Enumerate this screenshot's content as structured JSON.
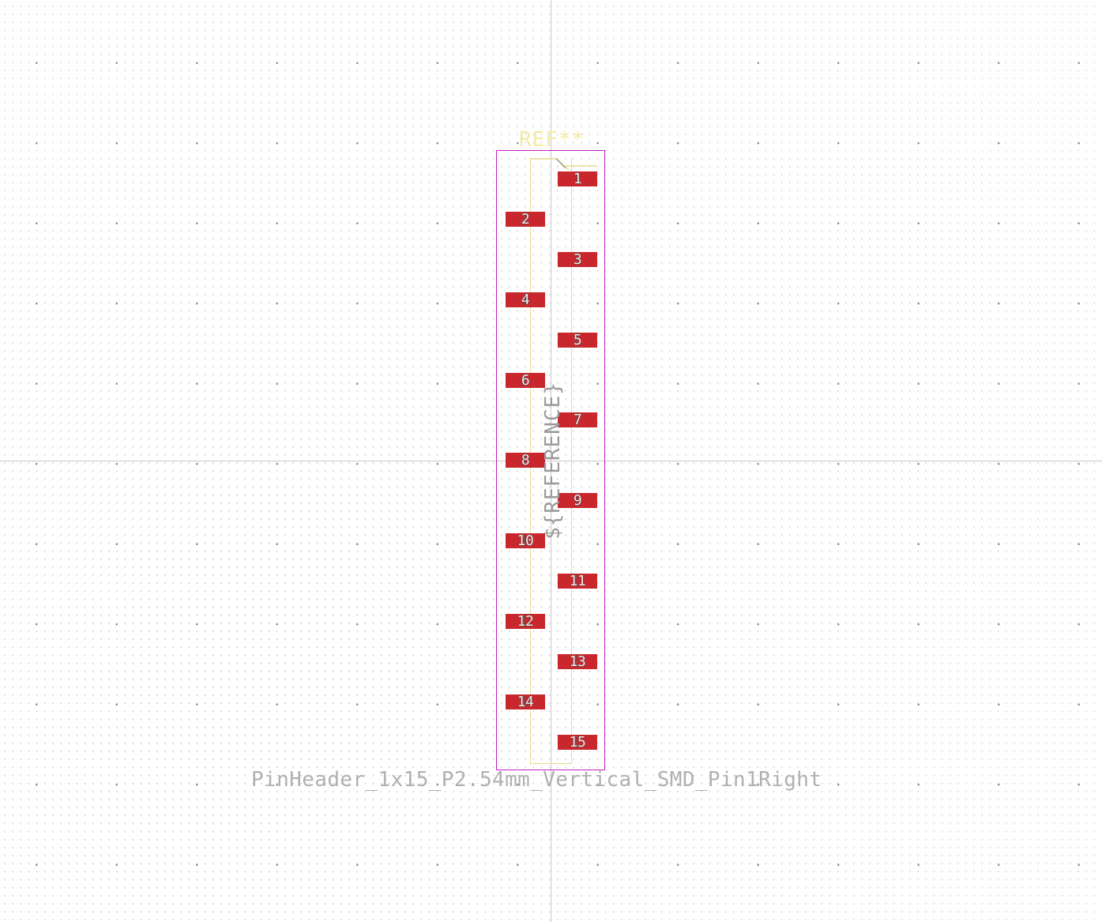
{
  "footprint": {
    "reference": "REF**",
    "reference_field": "${REFERENCE}",
    "value": "PinHeader_1x15_P2.54mm_Vertical_SMD_Pin1Right"
  },
  "pads": [
    {
      "number": "1",
      "side": "right"
    },
    {
      "number": "2",
      "side": "left"
    },
    {
      "number": "3",
      "side": "right"
    },
    {
      "number": "4",
      "side": "left"
    },
    {
      "number": "5",
      "side": "right"
    },
    {
      "number": "6",
      "side": "left"
    },
    {
      "number": "7",
      "side": "right"
    },
    {
      "number": "8",
      "side": "left"
    },
    {
      "number": "9",
      "side": "right"
    },
    {
      "number": "10",
      "side": "left"
    },
    {
      "number": "11",
      "side": "right"
    },
    {
      "number": "12",
      "side": "left"
    },
    {
      "number": "13",
      "side": "right"
    },
    {
      "number": "14",
      "side": "left"
    },
    {
      "number": "15",
      "side": "right"
    }
  ],
  "colors": {
    "pad": "#c8282d",
    "courtyard": "#c020c0",
    "silkscreen": "#e6dc8c",
    "fab_text": "#9a9a9a",
    "grid": "#c8c8c8"
  }
}
